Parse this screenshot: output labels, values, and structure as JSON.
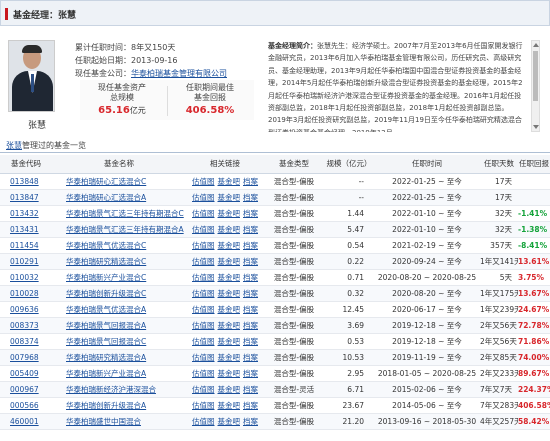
{
  "header": {
    "title": "基金经理：张慧"
  },
  "manager": {
    "name": "张慧",
    "cumulative_tenure": "累计任职时间：8年又150天",
    "current_company": "任职起始日期：2013-09-16",
    "current_company_name_label": "现任基金公司：",
    "current_company_name": "华泰柏瑞基金管理有限公司",
    "stats": {
      "aum_label_1": "现任基金资产",
      "aum_label_2": "总规模",
      "aum_value": "65.16",
      "aum_unit": "亿元",
      "best_label_1": "任职期间最佳",
      "best_label_2": "基金回报",
      "best_value": "406.58%"
    },
    "bio_label": "基金经理简介：",
    "bio_text": "张慧先生：经济学硕士。2007年7月至2013年6月任国家開发银行金融研究员，2013年6月加入华泰柏瑞基金管理有限公司，历任研究员、高级研究员、基金经理助理，2013年9月起任华泰柏瑞国中国混合型证券投资基金的基金经理，2014年5月起任华泰柏瑞创新升级混合型证券投资基金的基金经理，2015年2月起任华泰柏瑞新经济沪港深混合型证券投资基金的基金经理。2016年1月起任投资部副总监，2018年1月起任投资部副总监，2018年1月起任投资部副总监。2019年3月起任投资研究副总监，2019年11月19日至今任华泰柏瑞研究精选混合型证券投资基金基金经理，2019年12月"
  },
  "sub_header": {
    "link": "张慧",
    "text": "管理过的基金一览"
  },
  "table": {
    "headers": [
      "基金代码",
      "基金名称",
      "相关链接",
      "基金类型",
      "规模（亿元）",
      "任职时间",
      "任职天数",
      "任职回报"
    ],
    "link_labels": [
      "估值图",
      "基金吧",
      "档案"
    ],
    "rows": [
      {
        "code": "013848",
        "name": "华泰柏瑞研心汇选混合C",
        "type": "混合型-偏股",
        "scale": "--",
        "period": "2022-01-25 ~ 至今",
        "days": "17天",
        "ret": "",
        "sign": ""
      },
      {
        "code": "013847",
        "name": "华泰柏瑞研心汇选混合A",
        "type": "混合型-偏股",
        "scale": "--",
        "period": "2022-01-25 ~ 至今",
        "days": "17天",
        "ret": "",
        "sign": ""
      },
      {
        "code": "013432",
        "name": "华泰柏瑞景气汇选三年持有期混合C",
        "type": "混合型-偏股",
        "scale": "1.44",
        "period": "2022-01-10 ~ 至今",
        "days": "32天",
        "ret": "-1.41%",
        "sign": "neg"
      },
      {
        "code": "013431",
        "name": "华泰柏瑞景气汇选三年持有期混合A",
        "type": "混合型-偏股",
        "scale": "5.47",
        "period": "2022-01-10 ~ 至今",
        "days": "32天",
        "ret": "-1.38%",
        "sign": "neg"
      },
      {
        "code": "011454",
        "name": "华泰柏瑞景气优选混合C",
        "type": "混合型-偏股",
        "scale": "0.54",
        "period": "2021-02-19 ~ 至今",
        "days": "357天",
        "ret": "-8.41%",
        "sign": "neg"
      },
      {
        "code": "010291",
        "name": "华泰柏瑞研究精选混合C",
        "type": "混合型-偏股",
        "scale": "0.22",
        "period": "2020-09-24 ~ 至今",
        "days": "1年又141天",
        "ret": "13.61%",
        "sign": "pos"
      },
      {
        "code": "010032",
        "name": "华泰柏瑞新兴产业混合C",
        "type": "混合型-偏股",
        "scale": "0.71",
        "period": "2020-08-20 ~ 2020-08-25",
        "days": "5天",
        "ret": "3.75%",
        "sign": "pos"
      },
      {
        "code": "010028",
        "name": "华泰柏瑞创新升级混合C",
        "type": "混合型-偏股",
        "scale": "0.32",
        "period": "2020-08-20 ~ 至今",
        "days": "1年又175天",
        "ret": "13.67%",
        "sign": "pos"
      },
      {
        "code": "009636",
        "name": "华泰柏瑞景气优选混合A",
        "type": "混合型-偏股",
        "scale": "12.45",
        "period": "2020-06-17 ~ 至今",
        "days": "1年又239天",
        "ret": "24.67%",
        "sign": "pos"
      },
      {
        "code": "008373",
        "name": "华泰柏瑞景气回报混合A",
        "type": "混合型-偏股",
        "scale": "3.69",
        "period": "2019-12-18 ~ 至今",
        "days": "2年又56天",
        "ret": "72.78%",
        "sign": "pos"
      },
      {
        "code": "008374",
        "name": "华泰柏瑞景气回报混合C",
        "type": "混合型-偏股",
        "scale": "0.53",
        "period": "2019-12-18 ~ 至今",
        "days": "2年又56天",
        "ret": "71.86%",
        "sign": "pos"
      },
      {
        "code": "007968",
        "name": "华泰柏瑞研究精选混合A",
        "type": "混合型-偏股",
        "scale": "10.53",
        "period": "2019-11-19 ~ 至今",
        "days": "2年又85天",
        "ret": "74.00%",
        "sign": "pos"
      },
      {
        "code": "005409",
        "name": "华泰柏瑞新兴产业混合A",
        "type": "混合型-偏股",
        "scale": "2.95",
        "period": "2018-01-05 ~ 2020-08-25",
        "days": "2年又233天",
        "ret": "89.67%",
        "sign": "pos"
      },
      {
        "code": "000967",
        "name": "华泰柏瑞新经济沪港深混合",
        "type": "混合型-灵活",
        "scale": "6.71",
        "period": "2015-02-06 ~ 至今",
        "days": "7年又7天",
        "ret": "224.37%",
        "sign": "pos"
      },
      {
        "code": "000566",
        "name": "华泰柏瑞创新升级混合A",
        "type": "混合型-偏股",
        "scale": "23.67",
        "period": "2014-05-06 ~ 至今",
        "days": "7年又283天",
        "ret": "406.58%",
        "sign": "pos"
      },
      {
        "code": "460001",
        "name": "华泰柏瑞盛世中国混合",
        "type": "混合型-偏股",
        "scale": "21.20",
        "period": "2013-09-16 ~ 2018-05-30",
        "days": "4年又257天",
        "ret": "58.42%",
        "sign": "pos"
      }
    ]
  }
}
